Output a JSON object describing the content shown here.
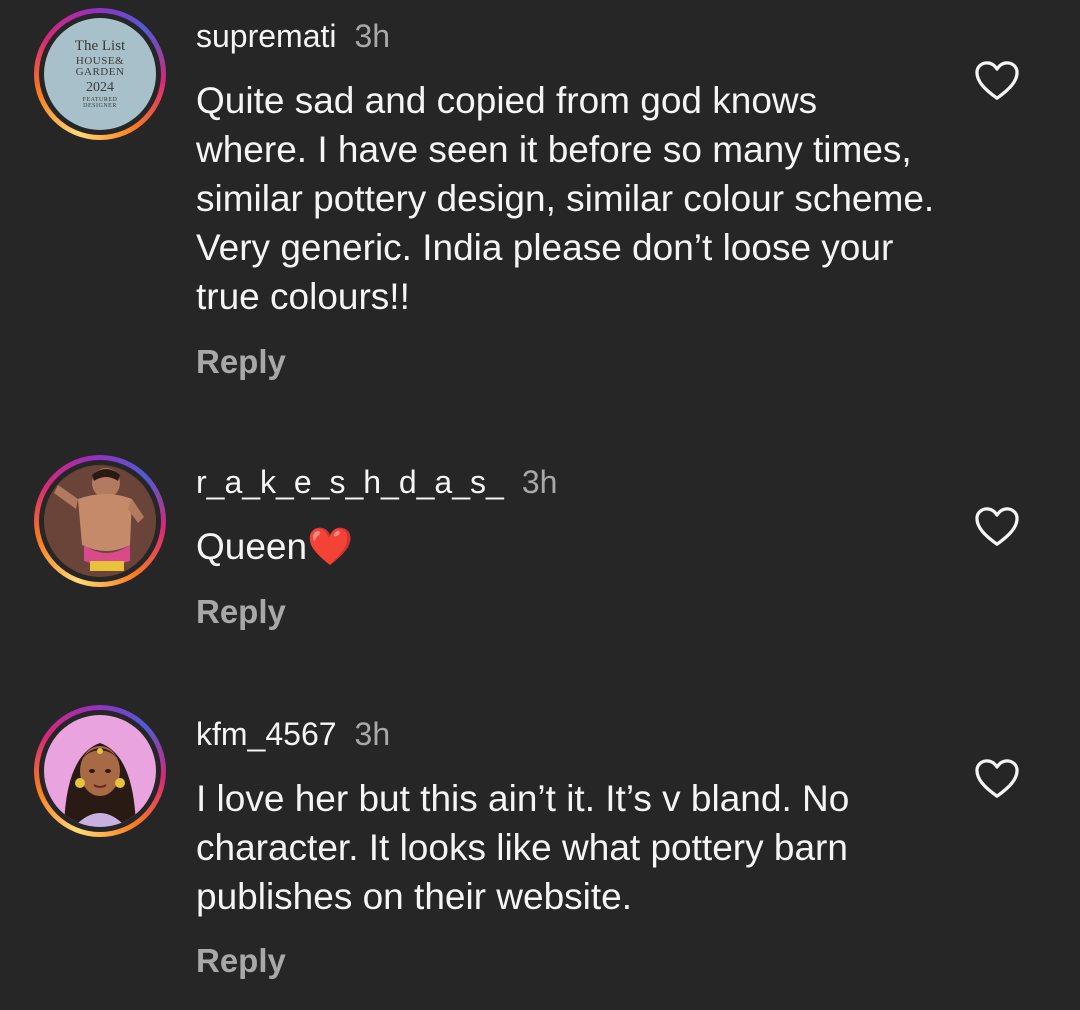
{
  "comments": [
    {
      "username": "supremati",
      "time": "3h",
      "text": "Quite sad and copied from god knows where. I have seen it before so many times, similar pottery design, similar colour scheme. Very generic. India please don’t loose your true colours!!",
      "reply_label": "Reply",
      "avatar_logo": {
        "line1": "The List",
        "line2": "HOUSE&",
        "line3": "GARDEN",
        "line4": "2024",
        "line5": "FEATURED",
        "line6": "DESIGNER"
      }
    },
    {
      "username": "r_a_k_e_s_h_d_a_s_",
      "time": "3h",
      "text": "Queen",
      "emoji": "❤️",
      "reply_label": "Reply"
    },
    {
      "username": "kfm_4567",
      "time": "3h",
      "text": "I love her but this ain’t it. It’s v bland. No character. It looks like what pottery barn publishes on their website.",
      "reply_label": "Reply"
    }
  ],
  "icons": {
    "like": "heart-outline-icon"
  },
  "colors": {
    "background": "#262626",
    "primary_text": "#f5f5f5",
    "secondary_text": "#a8a8a8"
  }
}
